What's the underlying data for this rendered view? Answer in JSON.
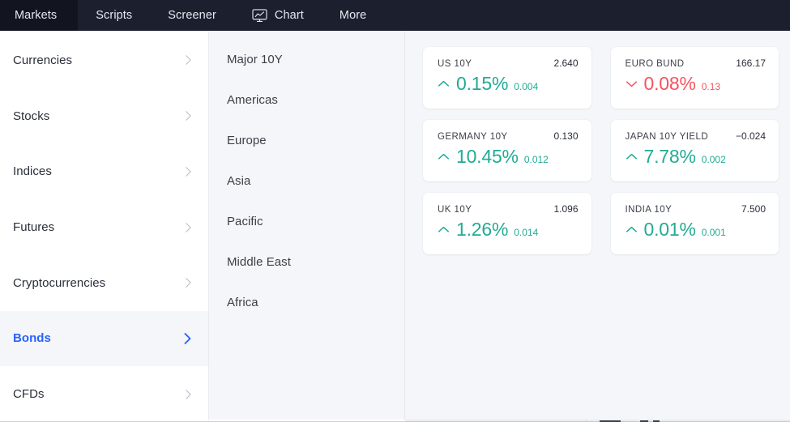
{
  "topnav": {
    "items": [
      {
        "label": "Markets",
        "icon": null,
        "active": true
      },
      {
        "label": "Scripts",
        "icon": null,
        "active": false
      },
      {
        "label": "Screener",
        "icon": null,
        "active": false
      },
      {
        "label": "Chart",
        "icon": "chart-monitor-icon",
        "active": false
      },
      {
        "label": "More",
        "icon": null,
        "active": false
      }
    ]
  },
  "sidebar": {
    "items": [
      {
        "label": "Currencies",
        "active": false
      },
      {
        "label": "Stocks",
        "active": false
      },
      {
        "label": "Indices",
        "active": false
      },
      {
        "label": "Futures",
        "active": false
      },
      {
        "label": "Cryptocurrencies",
        "active": false
      },
      {
        "label": "Bonds",
        "active": true
      },
      {
        "label": "CFDs",
        "active": false
      }
    ],
    "active_color": "#2962ff"
  },
  "regions": {
    "items": [
      {
        "label": "Major 10Y"
      },
      {
        "label": "Americas"
      },
      {
        "label": "Europe"
      },
      {
        "label": "Asia"
      },
      {
        "label": "Pacific"
      },
      {
        "label": "Middle East"
      },
      {
        "label": "Africa"
      }
    ]
  },
  "quotes": {
    "up_color": "#22ab94",
    "down_color": "#f7525f",
    "cards": [
      {
        "name": "US 10Y",
        "price": "2.640",
        "change_pct": "0.15%",
        "change_abs": "0.004",
        "direction": "up"
      },
      {
        "name": "EURO BUND",
        "price": "166.17",
        "change_pct": "0.08%",
        "change_abs": "0.13",
        "direction": "down"
      },
      {
        "name": "GERMANY 10Y",
        "price": "0.130",
        "change_pct": "10.45%",
        "change_abs": "0.012",
        "direction": "up"
      },
      {
        "name": "JAPAN 10Y YIELD",
        "price": "−0.024",
        "change_pct": "7.78%",
        "change_abs": "0.002",
        "direction": "up"
      },
      {
        "name": "UK 10Y",
        "price": "1.096",
        "change_pct": "1.26%",
        "change_abs": "0.014",
        "direction": "up"
      },
      {
        "name": "INDIA 10Y",
        "price": "7.500",
        "change_pct": "0.01%",
        "change_abs": "0.001",
        "direction": "up"
      }
    ]
  }
}
